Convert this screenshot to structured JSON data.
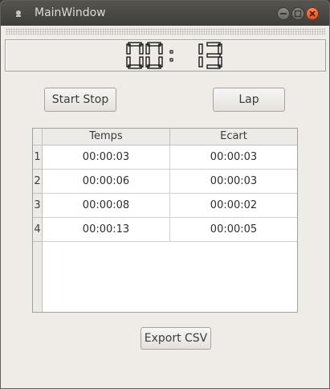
{
  "window": {
    "title": "MainWindow",
    "icon": "app-icon",
    "controls": [
      "minimize-icon",
      "maximize-icon",
      "close-icon"
    ]
  },
  "display": {
    "minutes": "00",
    "separator": ":",
    "seconds": "13"
  },
  "buttons": {
    "start_stop": "Start  Stop",
    "lap": "Lap",
    "export": "Export CSV"
  },
  "table": {
    "columns": [
      "Temps",
      "Ecart"
    ],
    "rows": [
      {
        "num": "1",
        "temps": "00:00:03",
        "ecart": "00:00:03"
      },
      {
        "num": "2",
        "temps": "00:00:06",
        "ecart": "00:00:03"
      },
      {
        "num": "3",
        "temps": "00:00:08",
        "ecart": "00:00:02"
      },
      {
        "num": "4",
        "temps": "00:00:13",
        "ecart": "00:00:05"
      }
    ]
  }
}
